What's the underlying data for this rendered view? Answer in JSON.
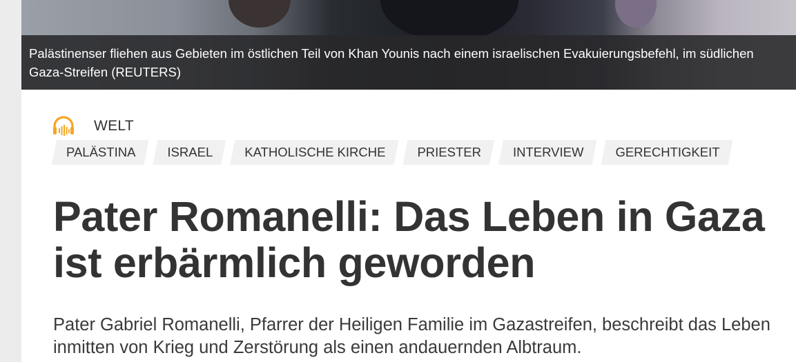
{
  "hero": {
    "caption": "Palästinenser fliehen aus Gebieten im östlichen Teil von Khan Younis nach einem israelischen Evakuierungsbefehl, im südlichen Gaza-Streifen  (REUTERS)"
  },
  "section": {
    "icon": "headphones-audio-icon",
    "icon_color": "#f5a623",
    "name": "WELT"
  },
  "tags": [
    "PALÄSTINA",
    "ISRAEL",
    "KATHOLISCHE KIRCHE",
    "PRIESTER",
    "INTERVIEW",
    "GERECHTIGKEIT"
  ],
  "article": {
    "headline": "Pater Romanelli: Das Leben in Gaza ist erbärmlich geworden",
    "lead": "Pater Gabriel Romanelli, Pfarrer der Heiligen Familie im Gazastreifen, beschreibt das Leben inmitten von Krieg und Zerstörung als einen andauernden Albtraum."
  }
}
